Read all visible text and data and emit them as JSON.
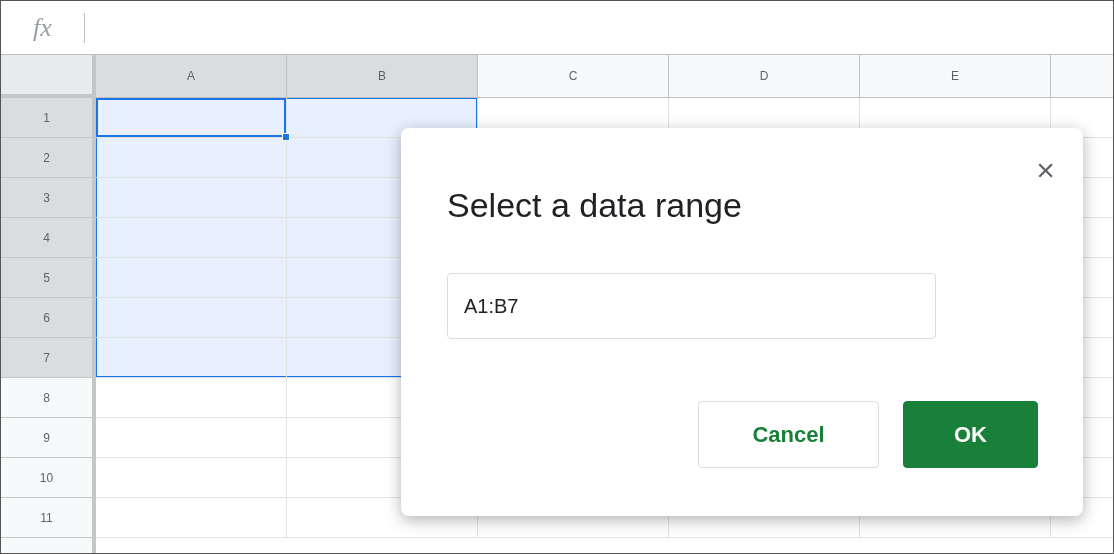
{
  "formula_bar": {
    "icon": "fx"
  },
  "columns": [
    {
      "label": "A",
      "selected": true,
      "active": true
    },
    {
      "label": "B",
      "selected": true,
      "active": false
    },
    {
      "label": "C",
      "selected": false,
      "active": false
    },
    {
      "label": "D",
      "selected": false,
      "active": false
    },
    {
      "label": "E",
      "selected": false,
      "active": false
    }
  ],
  "rows": [
    {
      "label": "1",
      "selected": true,
      "active": true
    },
    {
      "label": "2",
      "selected": true,
      "active": false
    },
    {
      "label": "3",
      "selected": true,
      "active": false
    },
    {
      "label": "4",
      "selected": true,
      "active": false
    },
    {
      "label": "5",
      "selected": true,
      "active": false
    },
    {
      "label": "6",
      "selected": true,
      "active": false
    },
    {
      "label": "7",
      "selected": true,
      "active": false
    },
    {
      "label": "8",
      "selected": false,
      "active": false
    },
    {
      "label": "9",
      "selected": false,
      "active": false
    },
    {
      "label": "10",
      "selected": false,
      "active": false
    },
    {
      "label": "11",
      "selected": false,
      "active": false
    }
  ],
  "dialog": {
    "title": "Select a data range",
    "close": "×",
    "range_field": {
      "value": "A1:B7"
    },
    "buttons": [
      {
        "label": "Cancel",
        "kind": "secondary"
      },
      {
        "label": "OK",
        "kind": "primary"
      }
    ]
  }
}
